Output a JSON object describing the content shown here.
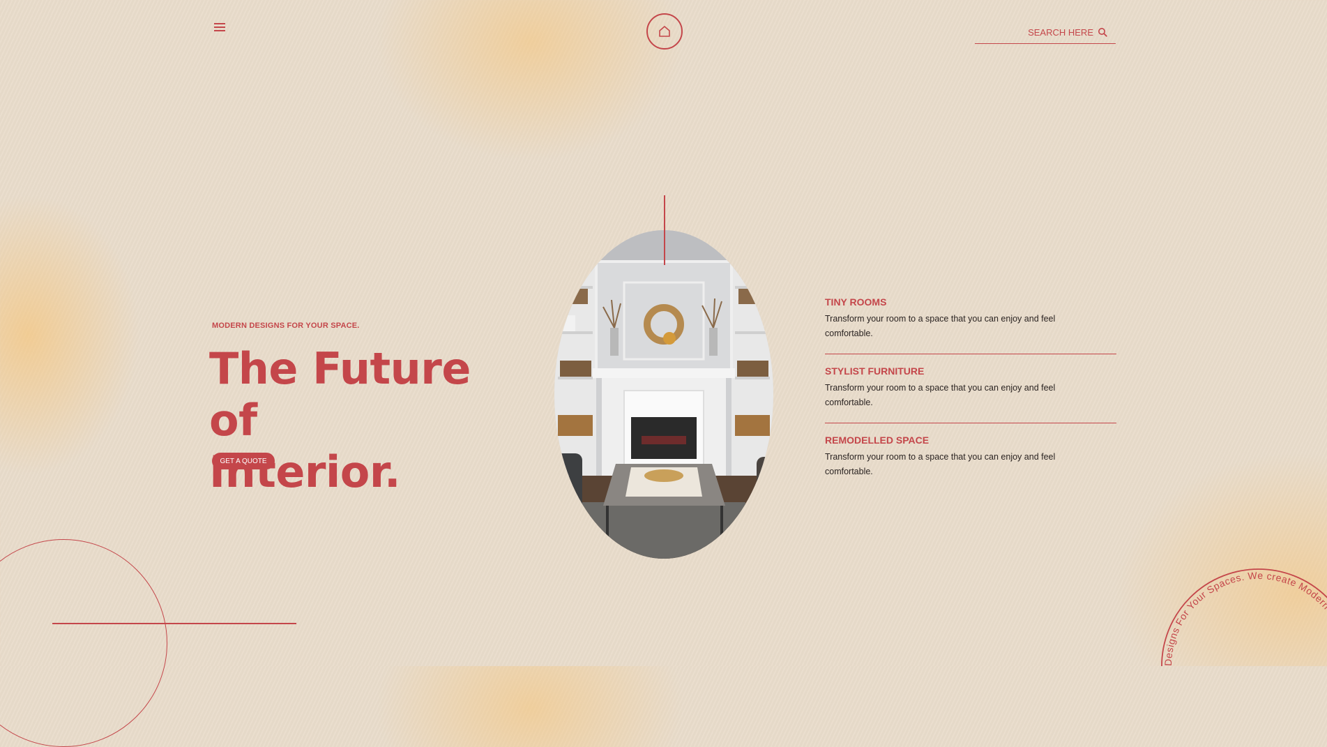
{
  "header": {
    "menu_icon": "hamburger-menu-icon",
    "logo_icon": "home-icon",
    "search": {
      "placeholder": "SEARCH HERE",
      "icon": "search-icon"
    }
  },
  "hero": {
    "tagline": "MODERN DESIGNS FOR YOUR SPACE.",
    "title_line1": "The Future of",
    "title_line2": "Interior.",
    "cta_label": "GET A QUOTE"
  },
  "features": [
    {
      "title": "TINY ROOMS",
      "text": "Transform your room to a space that you can enjoy and feel comfortable."
    },
    {
      "title": "STYLIST FURNITURE",
      "text": "Transform your room to a space that you can enjoy and feel comfortable."
    },
    {
      "title": "REMODELLED SPACE",
      "text": "Transform your room to a space that you can enjoy and feel comfortable."
    }
  ],
  "badge": {
    "circular_text": "Designs For Your Spaces. We create Modern"
  },
  "colors": {
    "accent": "#c4464a",
    "background": "#e9dccb",
    "body_text": "#2b2422"
  }
}
